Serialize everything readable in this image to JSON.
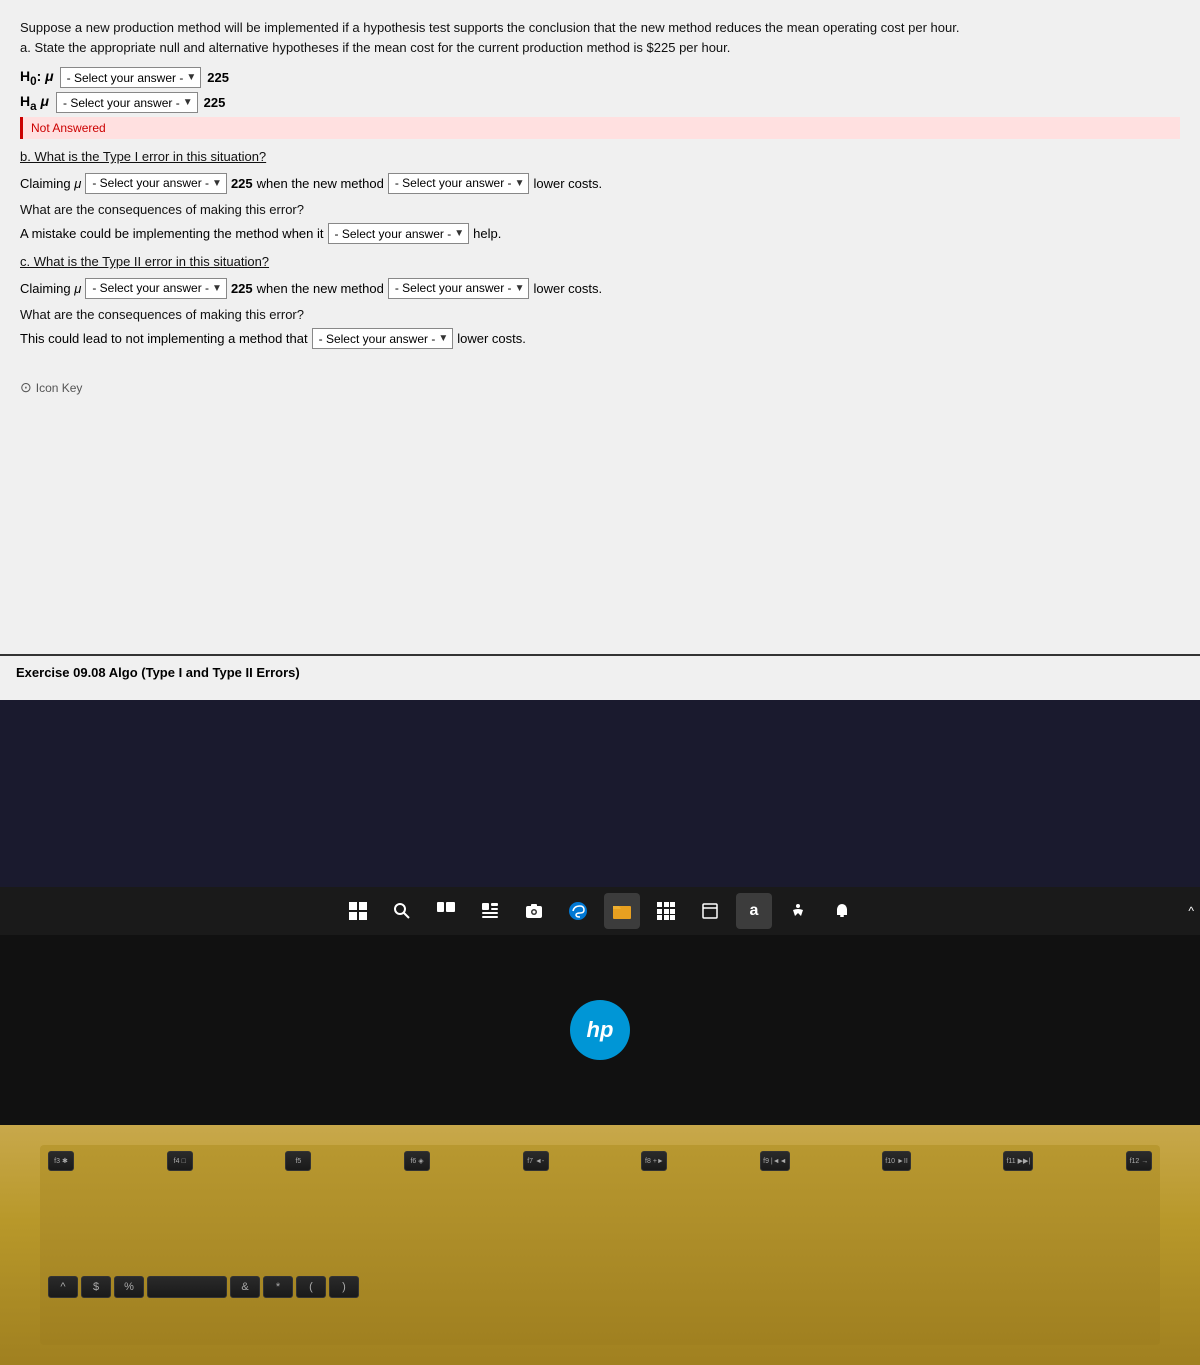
{
  "header": {
    "problem_intro": "Suppose a new production method will be implemented if a hypothesis test supports the conclusion that the new method reduces the mean operating cost per hour.",
    "problem_part_a": "a. State the appropriate null and alternative hypotheses if the mean cost for the current production method is $225 per hour."
  },
  "hypotheses": {
    "h0_label": "H₀: μ",
    "h0_value": "225",
    "h1_label": "H₁ μ",
    "h1_value": "225",
    "select_placeholder": "- Select your answer -",
    "not_answered_text": "Not Answered"
  },
  "part_b": {
    "title": "b. What is the Type I error in this situation?",
    "claiming_prefix": "Claiming μ",
    "value": "225",
    "suffix1": "when the new method",
    "suffix2": "lower costs.",
    "select1_placeholder": "- Select your answer -",
    "select2_placeholder": "- Select your answer -",
    "consequence_label": "What are the consequences of making this error?",
    "consequence_text": "A mistake could be implementing the method when it",
    "consequence_select": "- Select your answer -",
    "consequence_suffix": "help."
  },
  "part_c": {
    "title": "c. What is the Type II error in this situation?",
    "claiming_prefix": "Claiming μ",
    "value": "225",
    "suffix1": "when the new method",
    "suffix2": "lower costs.",
    "select1_placeholder": "- Select your answer -",
    "select2_placeholder": "- Select your answer -",
    "consequence_label": "What are the consequences of making this error?",
    "consequence_text": "This could lead to not implementing a method that",
    "consequence_select": "- Select your answer -",
    "consequence_suffix": "lower costs."
  },
  "icon_key": {
    "label": "Icon Key"
  },
  "footer": {
    "exercise_label": "Exercise 09.08 Algo (Type I and Type II Errors)"
  },
  "taskbar": {
    "icons": [
      "⊞",
      "🔍",
      "□",
      "▬",
      "📷",
      "🌐",
      "📁",
      "⊞",
      "□",
      "a",
      "❋",
      "🔊"
    ]
  },
  "keyboard": {
    "fn_keys": [
      "f3 *",
      "f4 □",
      "f5",
      "f6 40",
      "f7 ◄-",
      "f8 ◄+",
      "f9 I◄◄",
      "f10 ►II",
      "f11 ►►I",
      "f12 →"
    ],
    "bottom_row": [
      "^",
      "&",
      "*",
      "(",
      ")"
    ]
  }
}
